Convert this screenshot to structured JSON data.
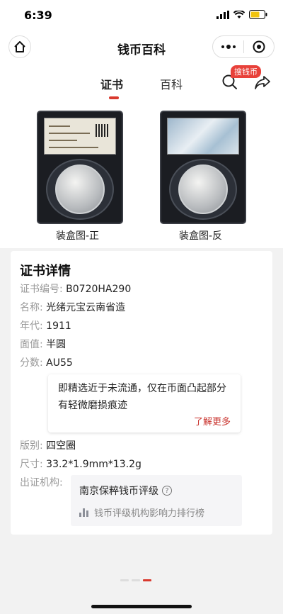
{
  "status": {
    "time": "6:39"
  },
  "nav": {
    "title": "钱币百科"
  },
  "tabs": [
    {
      "label": "证书"
    },
    {
      "label": "百科"
    }
  ],
  "search_badge": "搜钱币",
  "images": [
    {
      "caption": "装盒图-正",
      "label_text": "光绪元宝云南省造",
      "label_year": "1911",
      "label_grade": "AU55",
      "label_spec": "33.2*1.9mm*13.2g",
      "label_brand": "BAO CUI COINS RATING"
    },
    {
      "caption": "装盒图-反"
    }
  ],
  "details": {
    "title": "证书详情",
    "rows": [
      {
        "key": "证书编号:",
        "value": "B0720HA290"
      },
      {
        "key": "名称:",
        "value": "光绪元宝云南省造"
      },
      {
        "key": "年代:",
        "value": "1911"
      },
      {
        "key": "面值:",
        "value": "半圆"
      },
      {
        "key": "分数:",
        "value": "AU55"
      },
      {
        "key": "版别:",
        "value": "四空圈"
      },
      {
        "key": "尺寸:",
        "value": "33.2*1.9mm*13.2g"
      },
      {
        "key": "出证机构:",
        "value": ""
      }
    ],
    "grade_note": "即精选近于未流通，仅在币面凸起部分有轻微磨损痕迹",
    "learn_more": "了解更多",
    "org_name": "南京保粹钱币评级",
    "org_rank": "钱币评级机构影响力排行榜"
  },
  "colors": {
    "accent": "#d9392e"
  }
}
